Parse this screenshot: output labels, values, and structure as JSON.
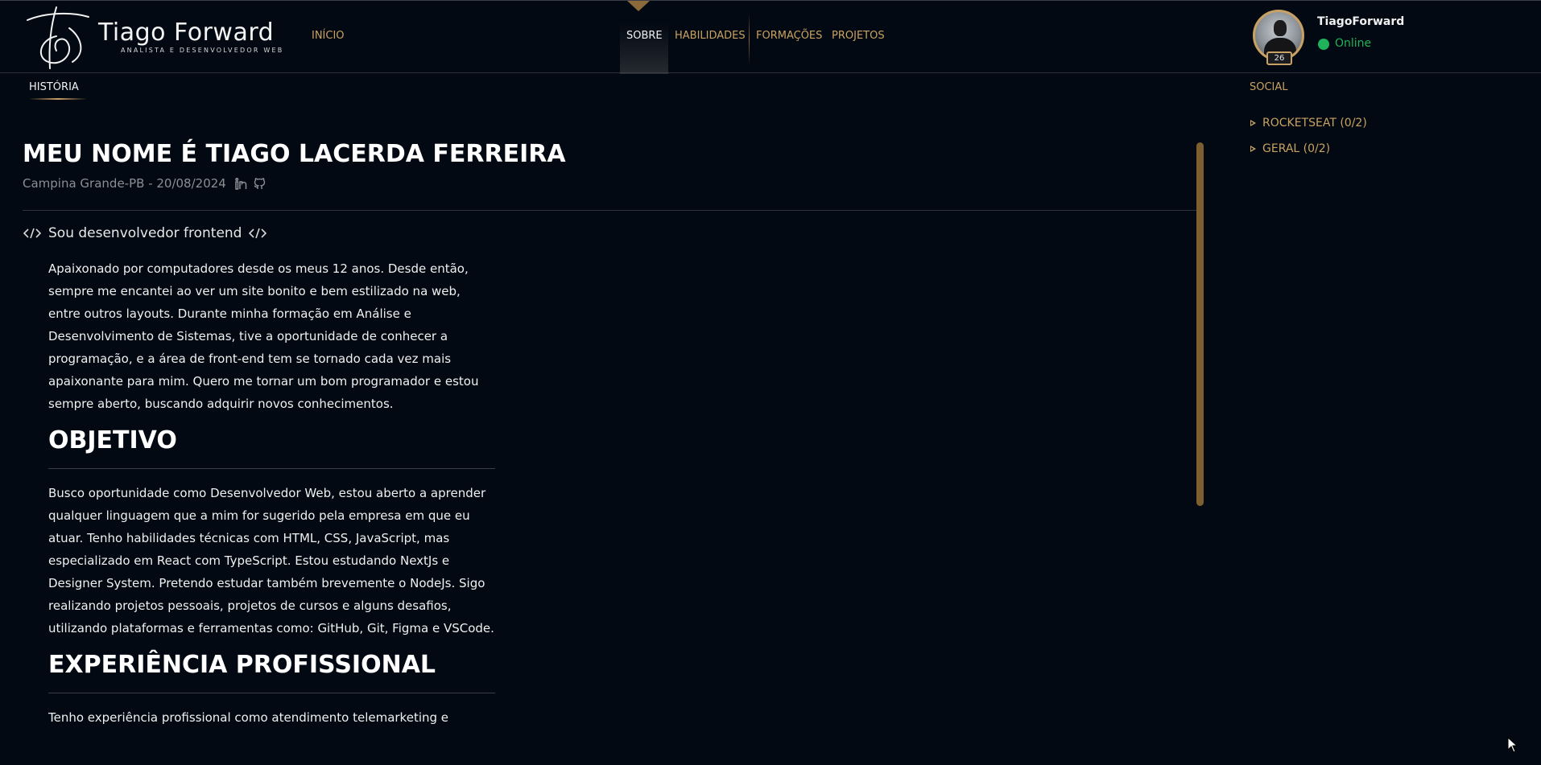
{
  "brand": {
    "title": "Tiago Forward",
    "subtitle": "ANALISTA E DESENVOLVEDOR WEB"
  },
  "nav": {
    "home": "INÍCIO",
    "tabs": [
      "SOBRE",
      "HABILIDADES",
      "FORMAÇÕES",
      "PROJETOS"
    ],
    "active": "SOBRE"
  },
  "profile": {
    "username": "TiagoForward",
    "status": "Online",
    "level": "26"
  },
  "main": {
    "section_tab": "HISTÓRIA",
    "title": "MEU NOME É TIAGO LACERDA FERREIRA",
    "location_date": "Campina Grande-PB - 20/08/2024",
    "code_heading": "Sou desenvolvedor frontend",
    "intro": "Apaixonado por computadores desde os meus 12 anos. Desde então, sempre me encantei ao ver um site bonito e bem estilizado na web, entre outros layouts. Durante minha formação em Análise e Desenvolvimento de Sistemas, tive a oportunidade de conhecer a programação, e a área de front-end tem se tornado cada vez mais apaixonante para mim. Quero me tornar um bom programador e estou sempre aberto, buscando adquirir novos conhecimentos.",
    "objective_title": "OBJETIVO",
    "objective_text": "Busco oportunidade como Desenvolvedor Web, estou aberto a aprender qualquer linguagem que a mim for sugerido pela empresa em que eu atuar. Tenho habilidades técnicas com HTML, CSS, JavaScript, mas especializado em React com TypeScript. Estou estudando NextJs e Designer System. Pretendo estudar também brevemente o NodeJs. Sigo realizando projetos pessoais, projetos de cursos e alguns desafios, utilizando plataformas e ferramentas como: GitHub, Git, Figma e VSCode.",
    "experience_title": "EXPERIÊNCIA PROFISSIONAL",
    "experience_text": "Tenho experiência profissional como atendimento telemarketing e"
  },
  "sidebar": {
    "title": "SOCIAL",
    "items": [
      {
        "label": "ROCKETSEAT (0/2)"
      },
      {
        "label": "GERAL (0/2)"
      }
    ]
  },
  "icons": {
    "linkedin": "linkedin-icon",
    "github": "github-icon",
    "code": "code-icon",
    "expand": "triangle-right-icon"
  },
  "colors": {
    "background": "#020912",
    "accent_gold": "#c9a262",
    "status_green": "#1fb25a",
    "scroll_thumb": "#7d5f2f"
  }
}
